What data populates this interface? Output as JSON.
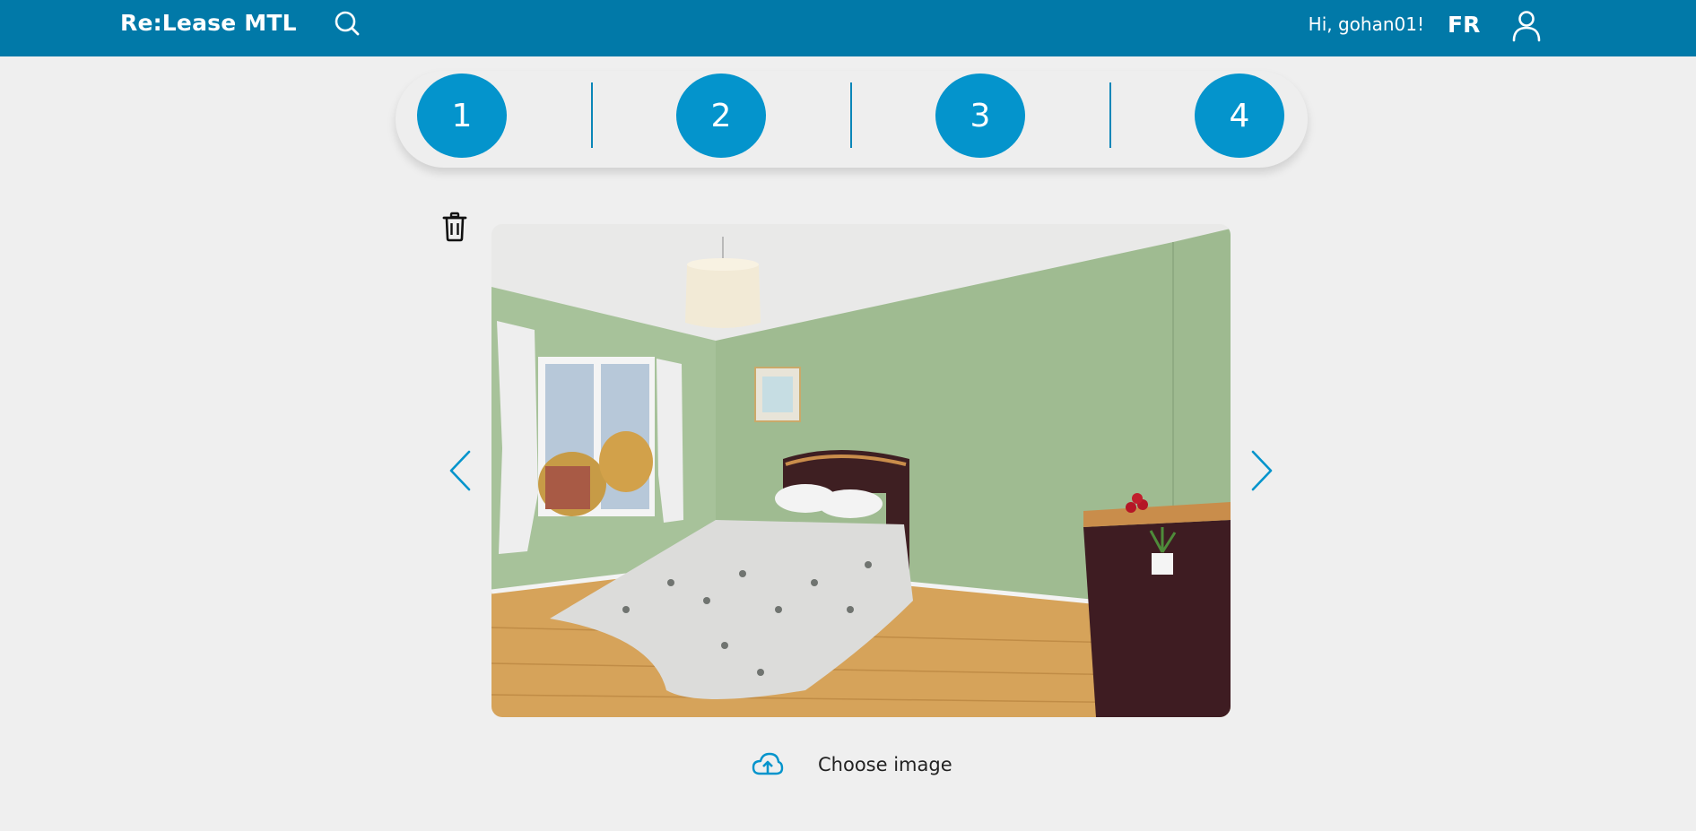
{
  "header": {
    "brand": "Re:Lease MTL",
    "greeting": "Hi, gohan01!",
    "language_toggle": "FR",
    "icons": {
      "search": "search-icon",
      "user": "user-icon"
    }
  },
  "stepper": {
    "steps": [
      "1",
      "2",
      "3",
      "4"
    ]
  },
  "gallery": {
    "icons": {
      "delete": "trash-icon",
      "previous": "chevron-left-icon",
      "next": "chevron-right-icon"
    },
    "upload_label": "Choose image",
    "upload_icon": "cloud-upload-icon"
  },
  "colors": {
    "header_bg": "#0179a8",
    "accent": "#0494cc",
    "page_bg": "#efefef"
  }
}
